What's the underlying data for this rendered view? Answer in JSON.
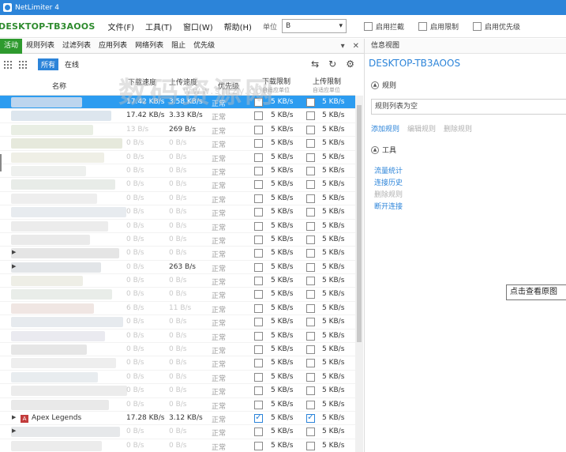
{
  "window": {
    "title": "NetLimiter 4"
  },
  "menubar": {
    "host": "DESKTOP-TB3AOOS",
    "menus": [
      "文件(F)",
      "工具(T)",
      "窗口(W)",
      "帮助(H)"
    ],
    "unit_label": "单位",
    "unit_value": "B",
    "toggles": [
      {
        "label": "启用拦截",
        "checked": false
      },
      {
        "label": "启用限制",
        "checked": false
      },
      {
        "label": "启用优先级",
        "checked": false
      }
    ]
  },
  "tabs": [
    "活动",
    "规则列表",
    "过滤列表",
    "应用列表",
    "网络列表",
    "阻止",
    "优先级"
  ],
  "toolbar": {
    "filter_all": "所有",
    "filter_online": "在线"
  },
  "table": {
    "headers": {
      "name": "名称",
      "down": "下载速度",
      "up": "上传速度",
      "priority": "优先级",
      "dl_limit": "下载限制",
      "dl_limit_sub": "自适应单位",
      "ul_limit": "上传限制",
      "ul_limit_sub": "自适应单位"
    },
    "rows": [
      {
        "expand": "",
        "name": "",
        "down": "17.42 KB/s",
        "up": "3.58 KB/s",
        "prio": "正常",
        "dl": "5 KB/s",
        "ul": "5 KB/s",
        "dcb": false,
        "ucb": false,
        "selected": true,
        "blur": "#bcd5ee"
      },
      {
        "expand": "",
        "name": "",
        "down": "17.42 KB/s",
        "up": "3.33 KB/s",
        "prio": "正常",
        "dl": "5 KB/s",
        "ul": "5 KB/s",
        "dcb": false,
        "ucb": false,
        "blur": "#dde6ee"
      },
      {
        "expand": "",
        "name": "",
        "down": "13 B/s",
        "up": "269 B/s",
        "prio": "正常",
        "dl": "5 KB/s",
        "ul": "5 KB/s",
        "dcb": false,
        "ucb": false,
        "dimdown": true,
        "blur": "#e9eee4"
      },
      {
        "expand": "",
        "name": "",
        "down": "0 B/s",
        "up": "0 B/s",
        "prio": "正常",
        "dl": "5 KB/s",
        "ul": "5 KB/s",
        "dcb": false,
        "ucb": false,
        "dim": true,
        "blur": "#e6e9dc"
      },
      {
        "expand": "",
        "name": "",
        "down": "0 B/s",
        "up": "0 B/s",
        "prio": "正常",
        "dl": "5 KB/s",
        "ul": "5 KB/s",
        "dcb": false,
        "ucb": false,
        "dim": true,
        "blur": "#efefe6"
      },
      {
        "expand": "",
        "name": "",
        "down": "0 B/s",
        "up": "0 B/s",
        "prio": "正常",
        "dl": "5 KB/s",
        "ul": "5 KB/s",
        "dcb": false,
        "ucb": false,
        "dim": true,
        "blur": "#eef0ee"
      },
      {
        "expand": "",
        "name": "",
        "down": "0 B/s",
        "up": "0 B/s",
        "prio": "正常",
        "dl": "5 KB/s",
        "ul": "5 KB/s",
        "dcb": false,
        "ucb": false,
        "dim": true,
        "blur": "#e8ece8"
      },
      {
        "expand": "",
        "name": "",
        "down": "0 B/s",
        "up": "0 B/s",
        "prio": "正常",
        "dl": "5 KB/s",
        "ul": "5 KB/s",
        "dcb": false,
        "ucb": false,
        "dim": true,
        "blur": "#eeeeee"
      },
      {
        "expand": "",
        "name": "",
        "down": "0 B/s",
        "up": "0 B/s",
        "prio": "正常",
        "dl": "5 KB/s",
        "ul": "5 KB/s",
        "dcb": false,
        "ucb": false,
        "dim": true,
        "blur": "#e7ebef"
      },
      {
        "expand": "",
        "name": "",
        "down": "0 B/s",
        "up": "0 B/s",
        "prio": "正常",
        "dl": "5 KB/s",
        "ul": "5 KB/s",
        "dcb": false,
        "ucb": false,
        "dim": true,
        "blur": "#ececec"
      },
      {
        "expand": "",
        "name": "",
        "down": "0 B/s",
        "up": "0 B/s",
        "prio": "正常",
        "dl": "5 KB/s",
        "ul": "5 KB/s",
        "dcb": false,
        "ucb": false,
        "dim": true,
        "blur": "#eaeaea"
      },
      {
        "expand": "▶",
        "name": "",
        "down": "0 B/s",
        "up": "0 B/s",
        "prio": "正常",
        "dl": "5 KB/s",
        "ul": "5 KB/s",
        "dcb": false,
        "ucb": false,
        "dim": true,
        "blur": "#e5e5e5"
      },
      {
        "expand": "▶",
        "name": "",
        "down": "0 B/s",
        "up": "263 B/s",
        "prio": "正常",
        "dl": "5 KB/s",
        "ul": "5 KB/s",
        "dcb": false,
        "ucb": false,
        "dimdown": true,
        "blur": "#e2e5e8"
      },
      {
        "expand": "",
        "name": "",
        "down": "0 B/s",
        "up": "0 B/s",
        "prio": "正常",
        "dl": "5 KB/s",
        "ul": "5 KB/s",
        "dcb": false,
        "ucb": false,
        "dim": true,
        "blur": "#eeeee6"
      },
      {
        "expand": "",
        "name": "",
        "down": "0 B/s",
        "up": "0 B/s",
        "prio": "正常",
        "dl": "5 KB/s",
        "ul": "5 KB/s",
        "dcb": false,
        "ucb": false,
        "dim": true,
        "blur": "#e9ede9"
      },
      {
        "expand": "",
        "name": "",
        "down": "6 B/s",
        "up": "11 B/s",
        "prio": "正常",
        "dl": "5 KB/s",
        "ul": "5 KB/s",
        "dcb": false,
        "ucb": false,
        "dim": true,
        "blur": "#f0e6e3"
      },
      {
        "expand": "",
        "name": "",
        "down": "0 B/s",
        "up": "0 B/s",
        "prio": "正常",
        "dl": "5 KB/s",
        "ul": "5 KB/s",
        "dcb": false,
        "ucb": false,
        "dim": true,
        "blur": "#e6eaee"
      },
      {
        "expand": "",
        "name": "",
        "down": "0 B/s",
        "up": "0 B/s",
        "prio": "正常",
        "dl": "5 KB/s",
        "ul": "5 KB/s",
        "dcb": false,
        "ucb": false,
        "dim": true,
        "blur": "#eaeaf0"
      },
      {
        "expand": "",
        "name": "",
        "down": "0 B/s",
        "up": "0 B/s",
        "prio": "正常",
        "dl": "5 KB/s",
        "ul": "5 KB/s",
        "dcb": false,
        "ucb": false,
        "dim": true,
        "blur": "#e6e6e6"
      },
      {
        "expand": "",
        "name": "",
        "down": "0 B/s",
        "up": "0 B/s",
        "prio": "正常",
        "dl": "5 KB/s",
        "ul": "5 KB/s",
        "dcb": false,
        "ucb": false,
        "dim": true,
        "blur": "#eeeeee"
      },
      {
        "expand": "",
        "name": "",
        "down": "0 B/s",
        "up": "0 B/s",
        "prio": "正常",
        "dl": "5 KB/s",
        "ul": "5 KB/s",
        "dcb": false,
        "ucb": false,
        "dim": true,
        "blur": "#e8ecef"
      },
      {
        "expand": "",
        "name": "",
        "down": "0 B/s",
        "up": "0 B/s",
        "prio": "正常",
        "dl": "5 KB/s",
        "ul": "5 KB/s",
        "dcb": false,
        "ucb": false,
        "dim": true,
        "blur": "#ececec"
      },
      {
        "expand": "",
        "name": "",
        "down": "0 B/s",
        "up": "0 B/s",
        "prio": "正常",
        "dl": "5 KB/s",
        "ul": "5 KB/s",
        "dcb": false,
        "ucb": false,
        "dim": true,
        "blur": "#e9e9e9"
      },
      {
        "expand": "▶",
        "name": "Apex Legends",
        "icon": "A",
        "down": "17.28 KB/s",
        "up": "3.12 KB/s",
        "prio": "正常",
        "dl": "5 KB/s",
        "ul": "5 KB/s",
        "dcb": true,
        "ucb": true
      },
      {
        "expand": "▶",
        "name": "",
        "down": "0 B/s",
        "up": "0 B/s",
        "prio": "正常",
        "dl": "5 KB/s",
        "ul": "5 KB/s",
        "dcb": false,
        "ucb": false,
        "dim": true,
        "blur": "#e6e8ea"
      },
      {
        "expand": "",
        "name": "",
        "down": "0 B/s",
        "up": "0 B/s",
        "prio": "正常",
        "dl": "5 KB/s",
        "ul": "5 KB/s",
        "dcb": false,
        "ucb": false,
        "dim": true,
        "blur": "#ececec"
      }
    ]
  },
  "info_panel": {
    "header": "信息视图",
    "host": "DESKTOP-TB3AOOS",
    "rules_title": "规则",
    "rules_empty": "规则列表为空",
    "rule_actions": [
      {
        "label": "添加规则",
        "enabled": true
      },
      {
        "label": "编辑规则",
        "enabled": false
      },
      {
        "label": "删除规则",
        "enabled": false
      }
    ],
    "tools_title": "工具",
    "tools": [
      {
        "label": "流量统计",
        "enabled": true
      },
      {
        "label": "连接历史",
        "enabled": true
      },
      {
        "label": "删除规则",
        "enabled": false
      },
      {
        "label": "断开连接",
        "enabled": true
      }
    ]
  },
  "tooltip": "点击查看原图",
  "watermark": {
    "text": "数码资源网",
    "url": "www.smzy.com"
  },
  "colors": {
    "accent": "#2c84d9",
    "host_green": "#2e8b2e",
    "tab_active": "#2e9a2e",
    "selected_row": "#2c9cf0"
  }
}
